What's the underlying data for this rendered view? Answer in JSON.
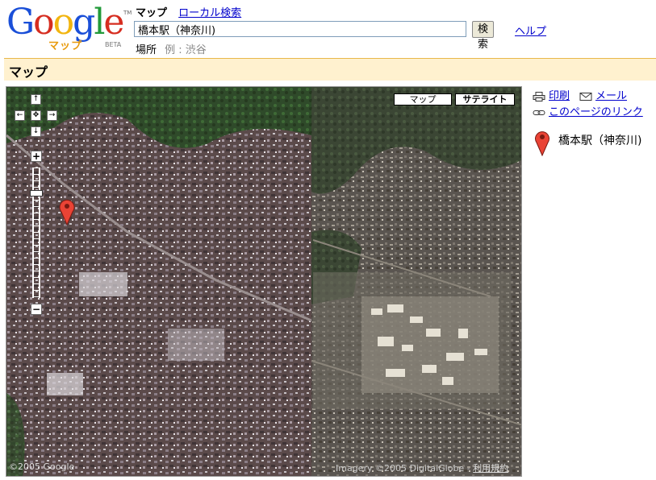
{
  "header": {
    "logo_text": "Google",
    "logo_sub": "マップ",
    "logo_beta": "BETA",
    "logo_tm": "TM",
    "nav_current": "マップ",
    "nav_link": "ローカル検索",
    "search_value": "橋本駅（神奈川)",
    "search_button": "検索",
    "help_link": "ヘルプ",
    "place_label": "場所",
    "place_example": "例 : 渋谷"
  },
  "section_title": "マップ",
  "map": {
    "type_map_label": "マップ",
    "type_satellite_label": "サテライト",
    "pan_up": "↑",
    "pan_left": "←",
    "pan_center": "✥",
    "pan_right": "→",
    "pan_down": "↓",
    "zoom_in": "+",
    "zoom_out": "−",
    "copyright_left": "©2005 Google",
    "copyright_right": "Imagery ©2005 DigitalGlobe - ",
    "terms_link": "利用規約"
  },
  "side": {
    "print_link": "印刷",
    "mail_link": "メール",
    "page_link": "このページのリンク",
    "result_name": "橋本駅（神奈川)"
  }
}
